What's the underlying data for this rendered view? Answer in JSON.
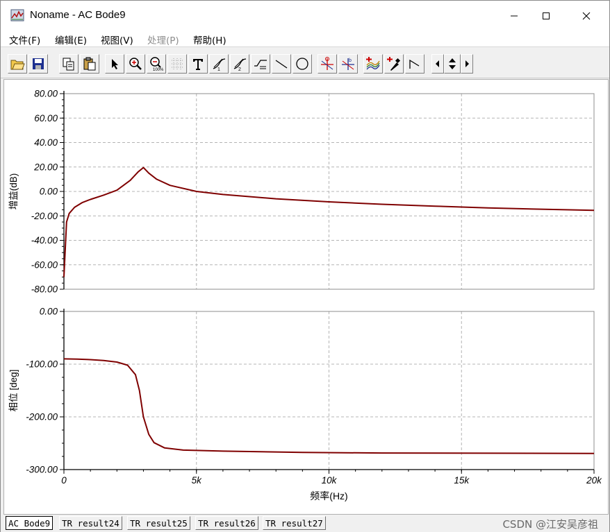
{
  "window": {
    "title": "Noname - AC Bode9",
    "minimize_icon": "minimize-icon",
    "maximize_icon": "maximize-icon",
    "close_icon": "close-icon"
  },
  "menu": [
    {
      "label": "文件(F)",
      "enabled": true
    },
    {
      "label": "编辑(E)",
      "enabled": true
    },
    {
      "label": "视图(V)",
      "enabled": true
    },
    {
      "label": "处理(P)",
      "enabled": false
    },
    {
      "label": "帮助(H)",
      "enabled": true
    }
  ],
  "toolbar": [
    "open-icon",
    "save-icon",
    "copy-icon",
    "paste-icon",
    "pointer-icon",
    "zoom-in-icon",
    "zoom-100-icon",
    "grid-icon",
    "text-icon",
    "cursor-1-icon",
    "cursor-2-icon",
    "cursor-3-icon",
    "line-icon",
    "ellipse-icon",
    "marker-a-icon",
    "marker-b-icon",
    "add-trace-icon",
    "probe-icon",
    "slope-icon",
    "scroll-left-icon",
    "scroll-updown-icon",
    "scroll-right-icon"
  ],
  "chart_data": [
    {
      "type": "line",
      "ylabel": "增益(dB)",
      "xlabel": "",
      "xlim": [
        0,
        20000
      ],
      "ylim": [
        -80,
        80
      ],
      "yticks": [
        "80.00",
        "60.00",
        "40.00",
        "20.00",
        "0.00",
        "-20.00",
        "-40.00",
        "-60.00",
        "-80.00"
      ],
      "yticks_values": [
        80,
        60,
        40,
        20,
        0,
        -20,
        -40,
        -60,
        -80
      ],
      "grid": true,
      "line_color": "#7f0000",
      "series": [
        {
          "x": [
            0,
            100,
            200,
            400,
            700,
            1000,
            1500,
            2000,
            2500,
            2800,
            3000,
            3200,
            3500,
            4000,
            5000,
            6000,
            8000,
            10000,
            12000,
            14000,
            16000,
            18000,
            20000
          ],
          "values": [
            -70,
            -25,
            -18,
            -13,
            -9,
            -6.5,
            -3,
            1,
            9,
            16,
            19.5,
            15,
            10,
            5,
            0,
            -2.5,
            -6,
            -8.5,
            -10.5,
            -12,
            -13.5,
            -14.5,
            -15.5
          ]
        }
      ]
    },
    {
      "type": "line",
      "ylabel": "相位 [deg]",
      "xlabel": "频率(Hz)",
      "xlim": [
        0,
        20000
      ],
      "ylim": [
        -300,
        0
      ],
      "xticks": [
        "0",
        "5k",
        "10k",
        "15k",
        "20k"
      ],
      "xticks_values": [
        0,
        5000,
        10000,
        15000,
        20000
      ],
      "yticks": [
        "0.00",
        "-100.00",
        "-200.00",
        "-300.00"
      ],
      "yticks_values": [
        0,
        -100,
        -200,
        -300
      ],
      "grid": true,
      "line_color": "#7f0000",
      "series": [
        {
          "x": [
            0,
            500,
            1000,
            1500,
            2000,
            2400,
            2700,
            2850,
            3000,
            3200,
            3400,
            3800,
            4500,
            6000,
            9000,
            12000,
            16000,
            20000
          ],
          "values": [
            -90,
            -90.5,
            -91.5,
            -93,
            -96,
            -102,
            -120,
            -150,
            -200,
            -233,
            -249,
            -259,
            -263,
            -265,
            -267.5,
            -268.5,
            -269,
            -269.5
          ]
        }
      ]
    }
  ],
  "tabs": [
    {
      "label": "AC Bode9",
      "active": true
    },
    {
      "label": "TR result24",
      "active": false
    },
    {
      "label": "TR result25",
      "active": false
    },
    {
      "label": "TR result26",
      "active": false
    },
    {
      "label": "TR result27",
      "active": false
    }
  ],
  "watermark": "CSDN @江安吴彦祖"
}
